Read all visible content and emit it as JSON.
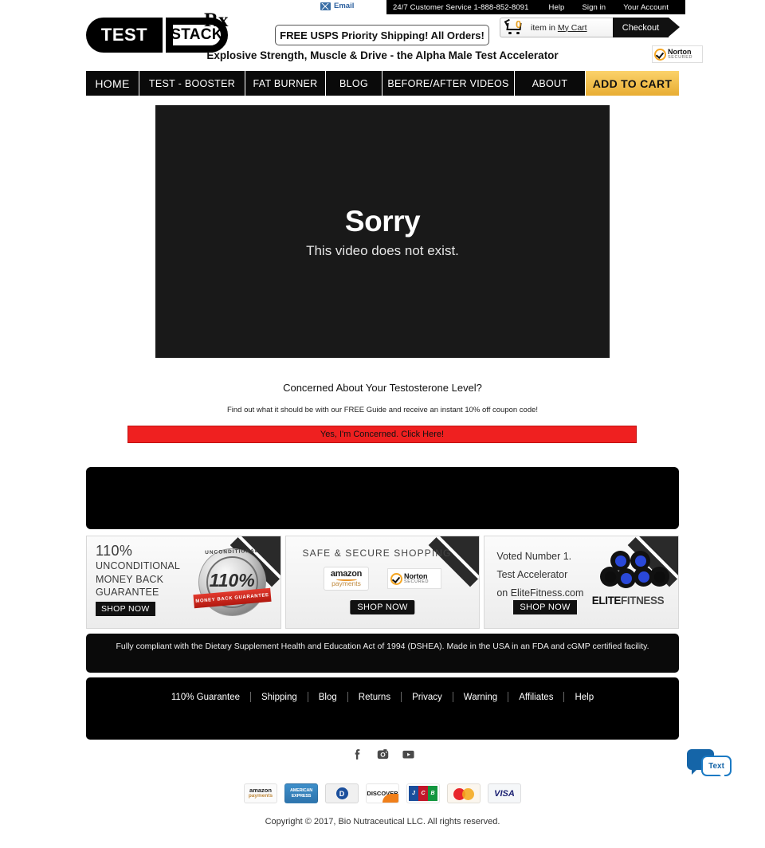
{
  "colors": {
    "brand_black": "#000000",
    "cta_yellow": "#e8ad33",
    "alert_red": "#ef2020",
    "link_blue": "#2b5f9e",
    "norton_orange": "#f5a623",
    "elite_blue": "#2a48d8"
  },
  "utility": {
    "phone_text": "24/7 Customer Service 1-888-852-8091",
    "links": [
      {
        "label": "Help"
      },
      {
        "label": "Sign in"
      },
      {
        "label": "Your Account"
      }
    ],
    "email_label": "Email",
    "email_icon": "envelope-icon"
  },
  "logo": {
    "word_one": "TEST",
    "word_two": "STACK",
    "superscript": "Rx"
  },
  "header": {
    "shipping_banner": "FREE USPS Priority Shipping! All Orders!",
    "tagline": "Explosive Strength, Muscle & Drive - the Alpha Male Test Accelerator",
    "norton": {
      "line1": "Norton",
      "line2": "SECURED",
      "icon": "checkmark-shield-icon"
    }
  },
  "cart": {
    "count": "0",
    "icon": "shopping-cart-icon",
    "text_prefix": "item in ",
    "my_cart_label": "My Cart",
    "checkout_label": "Checkout"
  },
  "nav": {
    "items": [
      {
        "label": "HOME",
        "key": "home"
      },
      {
        "label": "TEST - BOOSTER",
        "key": "booster"
      },
      {
        "label": "FAT BURNER",
        "key": "fat"
      },
      {
        "label": "BLOG",
        "key": "blog"
      },
      {
        "label": "BEFORE/AFTER VIDEOS",
        "key": "videos"
      },
      {
        "label": "ABOUT",
        "key": "about"
      },
      {
        "label": "ADD TO CART",
        "key": "cta"
      }
    ]
  },
  "video": {
    "error_title": "Sorry",
    "error_message": "This video does not exist."
  },
  "concerned": {
    "heading": "Concerned About Your Testosterone Level?",
    "subheading": "Find out what it should be with our FREE Guide and receive an instant 10% off coupon code!",
    "cta_label": "Yes, I'm Concerned. Click Here!"
  },
  "promos": [
    {
      "big_line": "110%",
      "line2": "UNCONDITIONAL",
      "line3": "MONEY BACK",
      "line4": "GUARANTEE",
      "shop_label": "SHOP NOW",
      "seal": {
        "arc_text": "UNCONDITIONAL",
        "number": "110%",
        "ribbon_text": "MONEY BACK GUARANTEE"
      }
    },
    {
      "heading": "SAFE & SECURE SHOPPING",
      "shop_label": "SHOP NOW",
      "badges": [
        {
          "name": "amazon-payments-badge",
          "line1": "amazon",
          "line2": "payments"
        },
        {
          "name": "norton-secured-badge",
          "line1": "Norton",
          "line2": "SECURED"
        }
      ]
    },
    {
      "line1": "Voted Number 1.",
      "line2": "Test Accelerator",
      "line3": "on EliteFitness.com",
      "shop_label": "SHOP NOW",
      "logo_word_a": "ELITE",
      "logo_word_b": "FITNESS"
    }
  ],
  "compliance": {
    "text": "Fully compliant with the Dietary Supplement Health and Education Act of 1994 (DSHEA). Made in the USA in an FDA and cGMP certified facility."
  },
  "footer": {
    "links": [
      {
        "label": "110% Guarantee"
      },
      {
        "label": "Shipping"
      },
      {
        "label": "Blog"
      },
      {
        "label": "Returns"
      },
      {
        "label": "Privacy"
      },
      {
        "label": "Warning"
      },
      {
        "label": "Affiliates"
      },
      {
        "label": "Help"
      }
    ],
    "social": [
      {
        "name": "facebook-icon"
      },
      {
        "name": "instagram-icon"
      },
      {
        "name": "youtube-icon"
      }
    ],
    "payments": [
      {
        "name": "amazon-payments-icon",
        "line1": "amazon",
        "line2": "payments"
      },
      {
        "name": "american-express-icon",
        "label": "AMERICAN\nEXPRESS"
      },
      {
        "name": "diners-club-icon",
        "label": "D"
      },
      {
        "name": "discover-icon",
        "label": "DISCOVER"
      },
      {
        "name": "jcb-icon",
        "l1": "J",
        "l2": "C",
        "l3": "B"
      },
      {
        "name": "mastercard-icon",
        "label": ""
      },
      {
        "name": "visa-icon",
        "label": "VISA"
      }
    ],
    "copyright": "Copyright © 2017, Bio Nutraceutical LLC. All rights reserved."
  },
  "chat": {
    "label": "Text",
    "icon": "chat-bubbles-icon"
  }
}
